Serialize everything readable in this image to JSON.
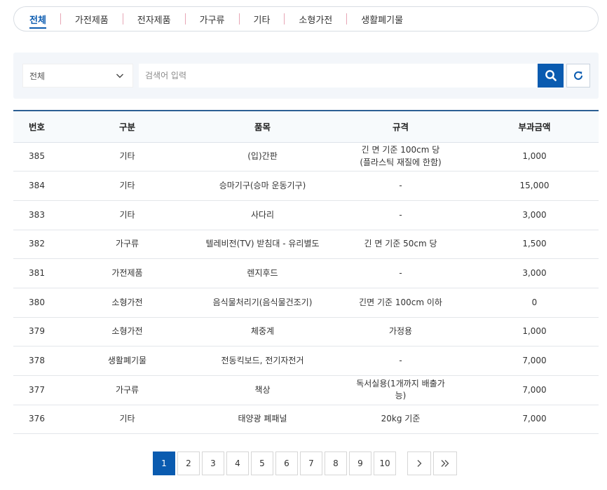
{
  "tabs": [
    {
      "label": "전체",
      "active": true
    },
    {
      "label": "가전제품"
    },
    {
      "label": "전자제품"
    },
    {
      "label": "가구류"
    },
    {
      "label": "기타"
    },
    {
      "label": "소형가전"
    },
    {
      "label": "생활폐기물"
    }
  ],
  "search": {
    "category_selected": "전체",
    "placeholder": "검색어 입력",
    "value": ""
  },
  "table": {
    "headers": [
      "번호",
      "구분",
      "품목",
      "규격",
      "부과금액"
    ],
    "rows": [
      [
        "385",
        "기타",
        "(입)간판",
        "긴 면 기준 100cm 당 (플라스틱 재질에 한함)",
        "1,000"
      ],
      [
        "384",
        "기타",
        "승마기구(승마 운동기구)",
        "-",
        "15,000"
      ],
      [
        "383",
        "기타",
        "사다리",
        "-",
        "3,000"
      ],
      [
        "382",
        "가구류",
        "텔레비전(TV) 받침대 - 유리별도",
        "긴 면 기준 50cm 당",
        "1,500"
      ],
      [
        "381",
        "가전제품",
        "렌지후드",
        "-",
        "3,000"
      ],
      [
        "380",
        "소형가전",
        "음식물처리기(음식물건조기)",
        "긴면 기준 100cm 이하",
        "0"
      ],
      [
        "379",
        "소형가전",
        "체중계",
        "가정용",
        "1,000"
      ],
      [
        "378",
        "생활폐기물",
        "전동킥보드, 전기자전거",
        "-",
        "7,000"
      ],
      [
        "377",
        "가구류",
        "책상",
        "독서실용(1개까지 배출가능)",
        "7,000"
      ],
      [
        "376",
        "기타",
        "태양광 폐패널",
        "20kg 기준",
        "7,000"
      ]
    ]
  },
  "pagination": {
    "pages": [
      "1",
      "2",
      "3",
      "4",
      "5",
      "6",
      "7",
      "8",
      "9",
      "10"
    ],
    "current": "1",
    "next_icon": "chevron-right-icon",
    "last_icon": "double-chevron-right-icon"
  },
  "colors": {
    "accent": "#0a5bb0",
    "tab_separator": "#e7a6b5",
    "search_bg": "#f3f6fa",
    "table_top_border": "#2c5f93"
  }
}
